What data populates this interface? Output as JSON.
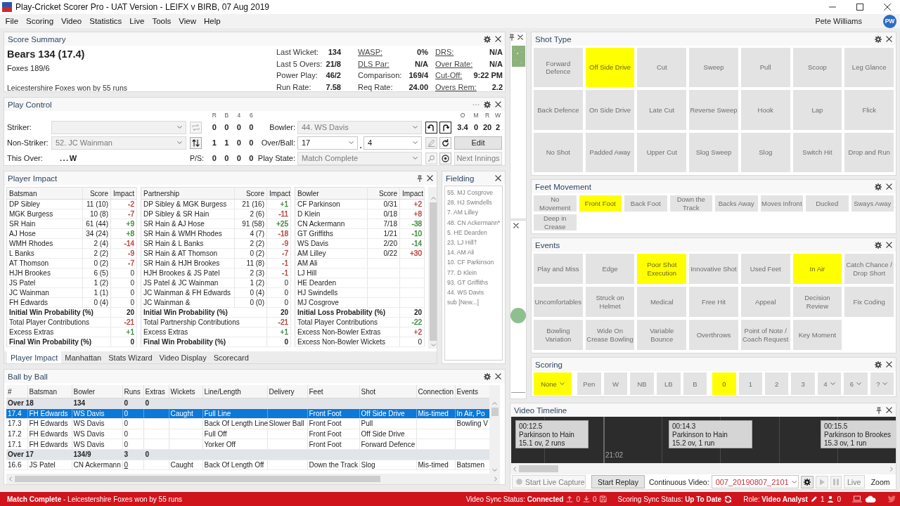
{
  "window": {
    "title": "Play-Cricket Scorer Pro - UAT Version - LEIFX v BIRB, 07 Aug 2019"
  },
  "menu": [
    "File",
    "Scoring",
    "Video",
    "Statistics",
    "Live",
    "Tools",
    "View",
    "Help"
  ],
  "user": {
    "name": "Pete Williams",
    "initials": "PW"
  },
  "score_summary": {
    "title": "Score Summary",
    "headline": "Bears 134 (17.4)",
    "subline": "Foxes 189/6",
    "result": "Leicestershire Foxes won by 55 runs",
    "stat_columns": [
      [
        {
          "label": "Last Wicket:",
          "value": "134",
          "kind": "plain"
        },
        {
          "label": "Last 5 Overs:",
          "value": "21/8",
          "kind": "plain"
        },
        {
          "label": "Power Play:",
          "value": "46/2",
          "kind": "plain"
        },
        {
          "label": "Run Rate:",
          "value": "7.58",
          "kind": "plain"
        }
      ],
      [
        {
          "label": "WASP:",
          "value": "0%",
          "kind": "link"
        },
        {
          "label": "DLS Par:",
          "value": "N/A",
          "kind": "link"
        },
        {
          "label": "Comparison:",
          "value": "169/4",
          "kind": "plain"
        },
        {
          "label": "Req Rate:",
          "value": "24.00",
          "kind": "plain"
        }
      ],
      [
        {
          "label": "DRS:",
          "value": "N/A",
          "kind": "link"
        },
        {
          "label": "Over Rate:",
          "value": "N/A",
          "kind": "link"
        },
        {
          "label": "Cut-Off:",
          "value": "9:22 PM",
          "kind": "link"
        },
        {
          "label": "Overs Rem:",
          "value": "2.2",
          "kind": "link"
        }
      ]
    ]
  },
  "play_control": {
    "title": "Play Control",
    "stat_headers": [
      "R",
      "B",
      "4",
      "6"
    ],
    "figure_headers": [
      "O",
      "M",
      "R",
      "W"
    ],
    "figures": [
      "3.4",
      "0",
      "20",
      "2"
    ],
    "striker": {
      "label": "Striker:",
      "disabled": true,
      "stats": [
        "0",
        "0",
        "0",
        "0"
      ]
    },
    "non_striker": {
      "label": "Non-Striker:",
      "value": "52. JC Wainman",
      "disabled": true,
      "stats": [
        "1",
        "1",
        "0",
        "0"
      ]
    },
    "this_over": {
      "label": "This Over:",
      "value": "...W"
    },
    "p_s": {
      "label": "P/S:",
      "stats": [
        "0",
        "0",
        "0",
        "0"
      ]
    },
    "bowler": {
      "label": "Bowler:",
      "value": "44. WS Davis",
      "disabled": true
    },
    "over_ball": {
      "label": "Over/Ball:",
      "over": "17",
      "separator": ".",
      "ball": "4",
      "disabled": false
    },
    "play_state": {
      "label": "Play State:",
      "value": "Match Complete",
      "disabled": true
    },
    "edit_button": {
      "label": "Edit",
      "disabled": false
    },
    "next_button": {
      "label": "Next Innings",
      "disabled": true
    }
  },
  "player_impact": {
    "title": "Player Impact",
    "tables": [
      {
        "columns": [
          "Batsman",
          "Score",
          "Impact"
        ],
        "rows": [
          {
            "name": "DP Sibley",
            "score": "11 (10)",
            "impact": "-2",
            "color": "#b5473f"
          },
          {
            "name": "MGK Burgess",
            "score": "10 (8)",
            "impact": "-7",
            "color": "#b5473f"
          },
          {
            "name": "SR Hain",
            "score": "61 (44)",
            "impact": "+9",
            "color": "#3f8a3f"
          },
          {
            "name": "AJ Hose",
            "score": "34 (24)",
            "impact": "+8",
            "color": "#3f8a3f"
          },
          {
            "name": "WMH Rhodes",
            "score": "2 (4)",
            "impact": "-14",
            "color": "#b5473f"
          },
          {
            "name": "L Banks",
            "score": "2 (2)",
            "impact": "-9",
            "color": "#b5473f"
          },
          {
            "name": "AT Thomson",
            "score": "0 (2)",
            "impact": "-7",
            "color": "#b5473f"
          },
          {
            "name": "HJH Brookes",
            "score": "6 (5)",
            "impact": "0"
          },
          {
            "name": "JS Patel",
            "score": "1 (2)",
            "impact": "0"
          },
          {
            "name": "JC Wainman",
            "score": "1 (1)",
            "impact": "0"
          },
          {
            "name": "FH Edwards",
            "score": "0 (4)",
            "impact": "0"
          }
        ],
        "summary": [
          {
            "label": "Initial Win Probability (%)",
            "value": "20",
            "kind": "bold"
          },
          {
            "label": "Total Player Contributions",
            "value": "-21",
            "kind": "plain",
            "color": "#b5473f"
          },
          {
            "label": "Excess Extras",
            "value": "+1",
            "kind": "plain",
            "color": "#3f8a3f"
          },
          {
            "label": "Final Win Probability (%)",
            "value": "0",
            "kind": "bold"
          }
        ]
      },
      {
        "columns": [
          "Partnership",
          "Score",
          "Impact"
        ],
        "rows": [
          {
            "name": "DP Sibley & MGK Burgess",
            "score": "21 (16)",
            "impact": "+1",
            "color": "#3f8a3f"
          },
          {
            "name": "DP Sibley & SR Hain",
            "score": "2 (6)",
            "impact": "-11",
            "color": "#b5473f"
          },
          {
            "name": "SR Hain & AJ Hose",
            "score": "91 (58)",
            "impact": "+25",
            "color": "#3f8a3f"
          },
          {
            "name": "SR Hain & WMH Rhodes",
            "score": "4 (7)",
            "impact": "-18",
            "color": "#b5473f"
          },
          {
            "name": "SR Hain & L Banks",
            "score": "2 (2)",
            "impact": "-9",
            "color": "#b5473f"
          },
          {
            "name": "SR Hain & AT Thomson",
            "score": "0 (2)",
            "impact": "-7",
            "color": "#b5473f"
          },
          {
            "name": "SR Hain & HJH Brookes",
            "score": "11 (8)",
            "impact": "-1",
            "color": "#b5473f"
          },
          {
            "name": "HJH Brookes & JS Patel",
            "score": "2 (3)",
            "impact": "-1",
            "color": "#b5473f"
          },
          {
            "name": "JS Patel & JC Wainman",
            "score": "1 (2)",
            "impact": "0"
          },
          {
            "name": "JC Wainman & FH Edwards",
            "score": "0 (4)",
            "impact": "0"
          },
          {
            "name": "JC Wainman &",
            "score": "0 (0)",
            "impact": "0"
          }
        ],
        "summary": [
          {
            "label": "Initial Win Probability (%)",
            "value": "20",
            "kind": "bold"
          },
          {
            "label": "Total Partnership Contributions",
            "value": "-21",
            "kind": "plain",
            "color": "#b5473f"
          },
          {
            "label": "Excess Extras",
            "value": "+1",
            "kind": "plain",
            "color": "#3f8a3f"
          },
          {
            "label": "Final Win Probability (%)",
            "value": "0",
            "kind": "bold"
          }
        ]
      },
      {
        "columns": [
          "Bowler",
          "Score",
          "Impact"
        ],
        "rows": [
          {
            "name": "CF Parkinson",
            "score": "0/31",
            "impact": "+2",
            "color": "#b5473f"
          },
          {
            "name": "D Klein",
            "score": "0/18",
            "impact": "+8",
            "color": "#b5473f"
          },
          {
            "name": "CN Ackermann",
            "score": "7/18",
            "impact": "-38",
            "color": "#3f8a3f"
          },
          {
            "name": "GT Griffiths",
            "score": "1/21",
            "impact": "-10",
            "color": "#3f8a3f"
          },
          {
            "name": "WS Davis",
            "score": "2/20",
            "impact": "-14",
            "color": "#3f8a3f"
          },
          {
            "name": "AM Lilley",
            "score": "0/22",
            "impact": "+30",
            "color": "#b5473f"
          },
          {
            "name": "AM Ali"
          },
          {
            "name": "LJ Hill"
          },
          {
            "name": "HE Dearden"
          },
          {
            "name": "HJ Swindells"
          },
          {
            "name": "MJ Cosgrove"
          }
        ],
        "summary": [
          {
            "label": "Initial Loss Probability (%)",
            "value": "20",
            "kind": "bold"
          },
          {
            "label": "Total Player Contributions",
            "value": "-22",
            "kind": "plain",
            "color": "#3f8a3f"
          },
          {
            "label": "Excess Non-Bowler Extras",
            "value": "+2",
            "kind": "plain",
            "color": "#b5473f"
          },
          {
            "label": "Excess Non-Bowler Wickets",
            "value": "0",
            "kind": "plain"
          }
        ]
      }
    ],
    "tabs": [
      {
        "label": "Player Impact",
        "selected": true
      },
      {
        "label": "Manhattan",
        "selected": false
      },
      {
        "label": "Stats Wizard",
        "selected": false
      },
      {
        "label": "Video Display",
        "selected": false
      },
      {
        "label": "Scorecard",
        "selected": false
      }
    ]
  },
  "fielding": {
    "title": "Fielding",
    "players": [
      "55. MJ Cosgrove",
      "28. HJ Swindells",
      "7. AM Lilley",
      "48. CN Ackermann*",
      "5. HE Dearden",
      "23. LJ Hill†",
      "14. AM Ali",
      "10. CF Parkinson",
      "77. D Klein",
      "93. GT Griffiths",
      "44. WS Davis",
      "sub [New...]"
    ]
  },
  "ball_by_ball": {
    "title": "Ball by Ball",
    "columns": [
      "#",
      "Batsman",
      "Bowler",
      "Runs",
      "Extras",
      "Wickets",
      "Line/Length",
      "Delivery",
      "Feet",
      "Shot",
      "Connection",
      "Events"
    ],
    "rows": [
      {
        "kind": "over",
        "selected": false,
        "cells": [
          {
            "text": "Over 18",
            "colspan": 2
          },
          {
            "text": "134"
          },
          {
            "text": "0"
          },
          {
            "text": "0"
          }
        ]
      },
      {
        "kind": "ball",
        "selected": true,
        "runs_link": false,
        "cells": [
          "17.4",
          "FH Edwards",
          "WS Davis",
          "0",
          null,
          "Caught",
          "Full Line",
          null,
          "Front Foot",
          "Off Side Drive",
          "Mis-timed",
          "In Air, Po"
        ]
      },
      {
        "kind": "ball",
        "selected": false,
        "runs_link": false,
        "cells": [
          "17.3",
          "FH Edwards",
          "WS Davis",
          "0",
          null,
          null,
          "Back Of Length Line",
          "Slower Ball",
          "Front Foot",
          "Pull",
          null,
          "Bowling V"
        ]
      },
      {
        "kind": "ball",
        "selected": false,
        "runs_link": false,
        "cells": [
          "17.2",
          "FH Edwards",
          "WS Davis",
          "0",
          null,
          null,
          "Full Off",
          null,
          "Front Foot",
          "Off Side Drive",
          null,
          null
        ]
      },
      {
        "kind": "ball",
        "selected": false,
        "runs_link": false,
        "cells": [
          "17.1",
          "FH Edwards",
          "WS Davis",
          "0",
          null,
          null,
          "Yorker Off",
          null,
          "Front Foot",
          "Forward Defence",
          null,
          null
        ]
      },
      {
        "kind": "over",
        "selected": false,
        "cells": [
          {
            "text": "Over 17",
            "colspan": 2
          },
          {
            "text": "134/9"
          },
          {
            "text": "3"
          },
          {
            "text": "0"
          }
        ]
      },
      {
        "kind": "ball",
        "selected": false,
        "runs_link": true,
        "cells": [
          "16.6",
          "JS Patel",
          "CN Ackermann",
          "0",
          null,
          "Caught",
          "Back Of Length Off",
          null,
          "Down the Track",
          "Slog",
          "Mis-timed",
          "Batsmen"
        ]
      }
    ]
  },
  "shot_type": {
    "title": "Shot Type",
    "buttons": [
      {
        "label": "Forward Defence",
        "selected": false
      },
      {
        "label": "Off Side Drive",
        "selected": true
      },
      {
        "label": "Cut",
        "selected": false
      },
      {
        "label": "Sweep",
        "selected": false
      },
      {
        "label": "Pull",
        "selected": false
      },
      {
        "label": "Scoop",
        "selected": false
      },
      {
        "label": "Leg Glance",
        "selected": false
      },
      {
        "label": "Back Defence",
        "selected": false
      },
      {
        "label": "On Side Drive",
        "selected": false
      },
      {
        "label": "Late Cut",
        "selected": false
      },
      {
        "label": "Reverse Sweep",
        "selected": false
      },
      {
        "label": "Hook",
        "selected": false
      },
      {
        "label": "Lap",
        "selected": false
      },
      {
        "label": "Flick",
        "selected": false
      },
      {
        "label": "No Shot",
        "selected": false
      },
      {
        "label": "Padded Away",
        "selected": false
      },
      {
        "label": "Upper Cut",
        "selected": false
      },
      {
        "label": "Slog Sweep",
        "selected": false
      },
      {
        "label": "Slog",
        "selected": false
      },
      {
        "label": "Switch Hit",
        "selected": false
      },
      {
        "label": "Drop and Run",
        "selected": false
      }
    ]
  },
  "feet_movement": {
    "title": "Feet Movement",
    "buttons": [
      {
        "label": "No Movement",
        "selected": false
      },
      {
        "label": "Front Foot",
        "selected": true
      },
      {
        "label": "Back Foot",
        "selected": false
      },
      {
        "label": "Down the Track",
        "selected": false
      },
      {
        "label": "Backs Away",
        "selected": false
      },
      {
        "label": "Moves Infront",
        "selected": false
      },
      {
        "label": "Ducked",
        "selected": false
      },
      {
        "label": "Sways Away",
        "selected": false
      },
      {
        "label": "Deep in Crease",
        "selected": false
      }
    ]
  },
  "events": {
    "title": "Events",
    "buttons": [
      {
        "label": "Play and Miss",
        "selected": false
      },
      {
        "label": "Edge",
        "selected": false
      },
      {
        "label": "Poor Shot Execution",
        "selected": true
      },
      {
        "label": "Innovative Shot",
        "selected": false
      },
      {
        "label": "Used Feet",
        "selected": false
      },
      {
        "label": "In Air",
        "selected": true
      },
      {
        "label": "Catch Chance / Drop Short",
        "selected": false
      },
      {
        "label": "Uncomfortables",
        "selected": false
      },
      {
        "label": "Struck on Helmet",
        "selected": false
      },
      {
        "label": "Medical",
        "selected": false
      },
      {
        "label": "Free Hit",
        "selected": false
      },
      {
        "label": "Appeal",
        "selected": false
      },
      {
        "label": "Decision Review",
        "selected": false
      },
      {
        "label": "Fix Coding",
        "selected": false
      },
      {
        "label": "Bowling Variation",
        "selected": false
      },
      {
        "label": "Wide On Crease Bowling",
        "selected": false
      },
      {
        "label": "Variable Bounce",
        "selected": false
      },
      {
        "label": "Overthrows",
        "selected": false
      },
      {
        "label": "Point of Note / Coach Request",
        "selected": false
      },
      {
        "label": "Key Moment",
        "selected": false
      }
    ]
  },
  "scoring": {
    "title": "Scoring",
    "groups": [
      [
        {
          "label": "None",
          "kind": "select",
          "selected": true
        }
      ],
      [
        {
          "label": "Pen",
          "kind": "button",
          "selected": false
        },
        {
          "label": "W",
          "kind": "button",
          "selected": false
        },
        {
          "label": "NB",
          "kind": "button",
          "selected": false
        },
        {
          "label": "LB",
          "kind": "button",
          "selected": false
        },
        {
          "label": "B",
          "kind": "button",
          "selected": false
        }
      ],
      [
        {
          "label": "0",
          "kind": "button",
          "selected": true
        },
        {
          "label": "1",
          "kind": "button",
          "selected": false
        },
        {
          "label": "2",
          "kind": "button",
          "selected": false
        },
        {
          "label": "3",
          "kind": "button",
          "selected": false
        },
        {
          "label": "4",
          "kind": "menu",
          "selected": false
        },
        {
          "label": "6",
          "kind": "menu",
          "selected": false
        },
        {
          "label": "?",
          "kind": "menu",
          "selected": false
        }
      ]
    ]
  },
  "video_timeline": {
    "title": "Video Timeline",
    "clips": [
      {
        "time": "00:12.5",
        "title": "Parkinson to Hain",
        "detail": "15.1 ov, 2 runs"
      },
      {
        "time": "00:14.3",
        "title": "Parkinson to Hain",
        "detail": "15.2 ov, 1 run"
      },
      {
        "time": "00:15.5",
        "title": "Parkinson to Brookes",
        "detail": "15.3 ov, 1 run"
      }
    ],
    "marker": "21:02",
    "live_capture": {
      "label": "Start Live Capture",
      "disabled": true
    },
    "replay": {
      "label": "Start Replay"
    },
    "source_label": "Continuous Video:",
    "source": "007_20190807_2101",
    "live": {
      "label": "Live",
      "disabled": true
    },
    "zoom_label": "Zoom"
  },
  "status_bar": {
    "message": "**Match Complete** - Leicestershire Foxes won by 55 runs",
    "video_sync": "Video Sync Status: **Connected**",
    "uploads": "0",
    "downloads": "0",
    "scoring_sync": "Scoring Sync Status: **Up To Date**",
    "role": "Role: **Video Analyst**",
    "edits": "1",
    "users": "0"
  }
}
